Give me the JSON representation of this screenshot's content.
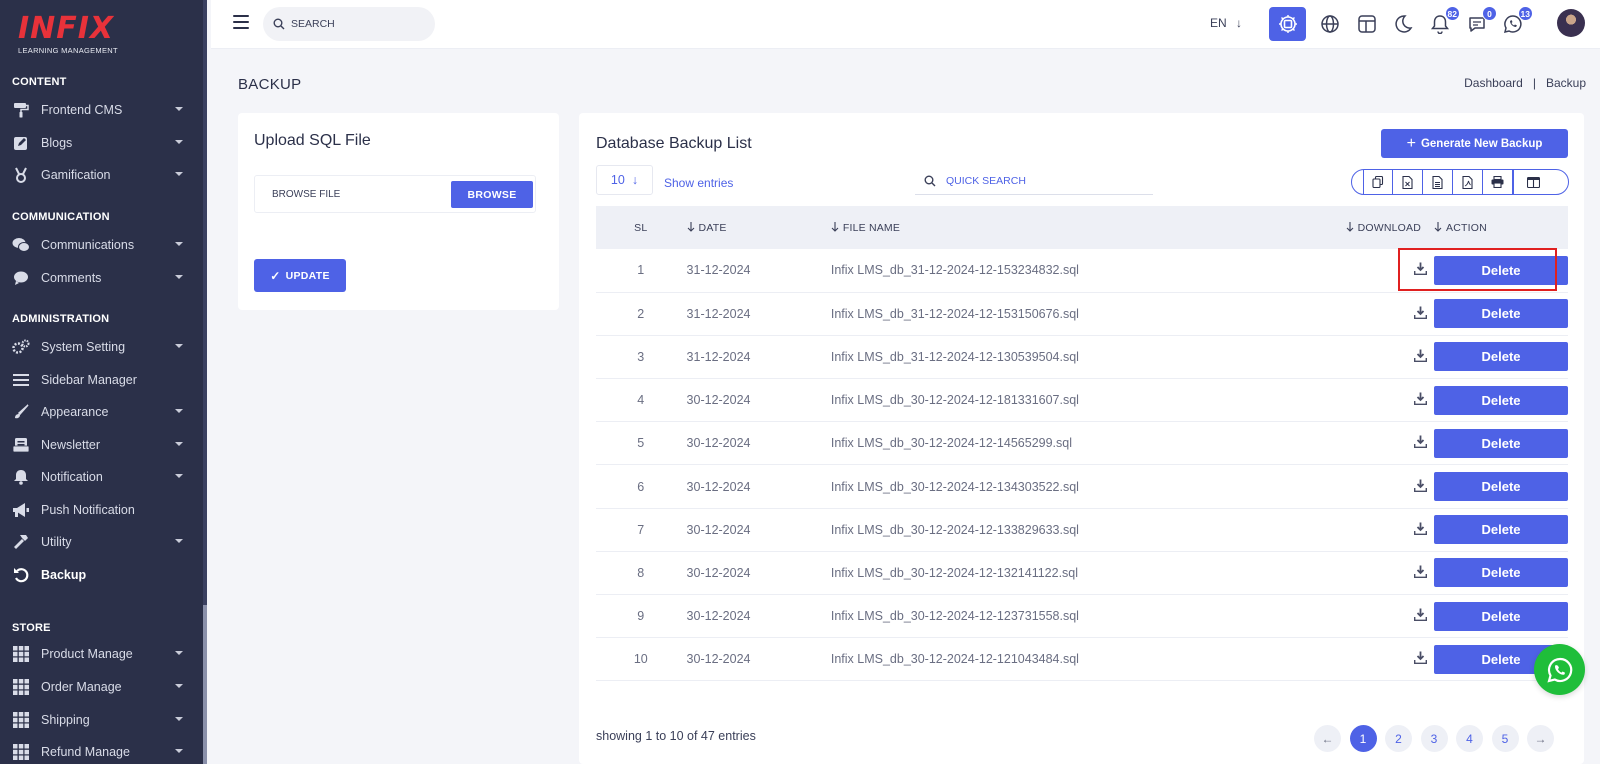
{
  "brand": {
    "logo_text": "INFIX",
    "logo_subtitle": "LEARNING MANAGEMENT",
    "accent_color": "#4e62e6",
    "sidebar_bg": "#2b3049"
  },
  "sidebar": {
    "sections": [
      {
        "title": "CONTENT"
      },
      {
        "title": "COMMUNICATION"
      },
      {
        "title": "ADMINISTRATION"
      },
      {
        "title": "STORE"
      }
    ],
    "items": [
      {
        "label": "Frontend CMS",
        "icon": "paint-roller-icon"
      },
      {
        "label": "Blogs",
        "icon": "edit-icon"
      },
      {
        "label": "Gamification",
        "icon": "medal-icon"
      },
      {
        "label": "Communications",
        "icon": "chat-bubbles-icon"
      },
      {
        "label": "Comments",
        "icon": "comment-icon"
      },
      {
        "label": "System Setting",
        "icon": "gears-icon"
      },
      {
        "label": "Sidebar Manager",
        "icon": "bars-icon"
      },
      {
        "label": "Appearance",
        "icon": "brush-icon"
      },
      {
        "label": "Newsletter",
        "icon": "newsletter-icon"
      },
      {
        "label": "Notification",
        "icon": "bell-icon"
      },
      {
        "label": "Push Notification",
        "icon": "megaphone-icon"
      },
      {
        "label": "Utility",
        "icon": "hammer-icon"
      },
      {
        "label": "Backup",
        "icon": "backup-icon"
      },
      {
        "label": "Product Manage",
        "icon": "grid-icon"
      },
      {
        "label": "Order Manage",
        "icon": "grid-icon"
      },
      {
        "label": "Shipping",
        "icon": "grid-icon"
      },
      {
        "label": "Refund Manage",
        "icon": "grid-icon"
      }
    ]
  },
  "topbar": {
    "search_placeholder": "SEARCH",
    "language": "EN",
    "badges": {
      "notifications": "82",
      "messages": "0",
      "whatsapp": "13"
    }
  },
  "page": {
    "title": "BACKUP",
    "breadcrumb": [
      "Dashboard",
      "Backup"
    ]
  },
  "upload": {
    "title": "Upload SQL File",
    "file_label": "BROWSE FILE",
    "browse_button": "BROWSE",
    "update_button": "UPDATE"
  },
  "backup_list": {
    "title": "Database Backup List",
    "generate_button": "Generate New Backup",
    "page_size": "10",
    "show_entries": "Show entries",
    "quick_search_placeholder": "QUICK SEARCH",
    "columns": [
      "SL",
      "DATE",
      "FILE NAME",
      "DOWNLOAD",
      "ACTION"
    ],
    "delete_label": "Delete",
    "rows": [
      {
        "sl": "1",
        "date": "31-12-2024",
        "file": "Infix LMS_db_31-12-2024-12-153234832.sql"
      },
      {
        "sl": "2",
        "date": "31-12-2024",
        "file": "Infix LMS_db_31-12-2024-12-153150676.sql"
      },
      {
        "sl": "3",
        "date": "31-12-2024",
        "file": "Infix LMS_db_31-12-2024-12-130539504.sql"
      },
      {
        "sl": "4",
        "date": "30-12-2024",
        "file": "Infix LMS_db_30-12-2024-12-181331607.sql"
      },
      {
        "sl": "5",
        "date": "30-12-2024",
        "file": "Infix LMS_db_30-12-2024-12-14565299.sql"
      },
      {
        "sl": "6",
        "date": "30-12-2024",
        "file": "Infix LMS_db_30-12-2024-12-134303522.sql"
      },
      {
        "sl": "7",
        "date": "30-12-2024",
        "file": "Infix LMS_db_30-12-2024-12-133829633.sql"
      },
      {
        "sl": "8",
        "date": "30-12-2024",
        "file": "Infix LMS_db_30-12-2024-12-132141122.sql"
      },
      {
        "sl": "9",
        "date": "30-12-2024",
        "file": "Infix LMS_db_30-12-2024-12-123731558.sql"
      },
      {
        "sl": "10",
        "date": "30-12-2024",
        "file": "Infix LMS_db_30-12-2024-12-121043484.sql"
      }
    ],
    "footer": "showing 1 to 10 of 47 entries",
    "pages": [
      "1",
      "2",
      "3",
      "4",
      "5"
    ],
    "current_page": "1"
  }
}
